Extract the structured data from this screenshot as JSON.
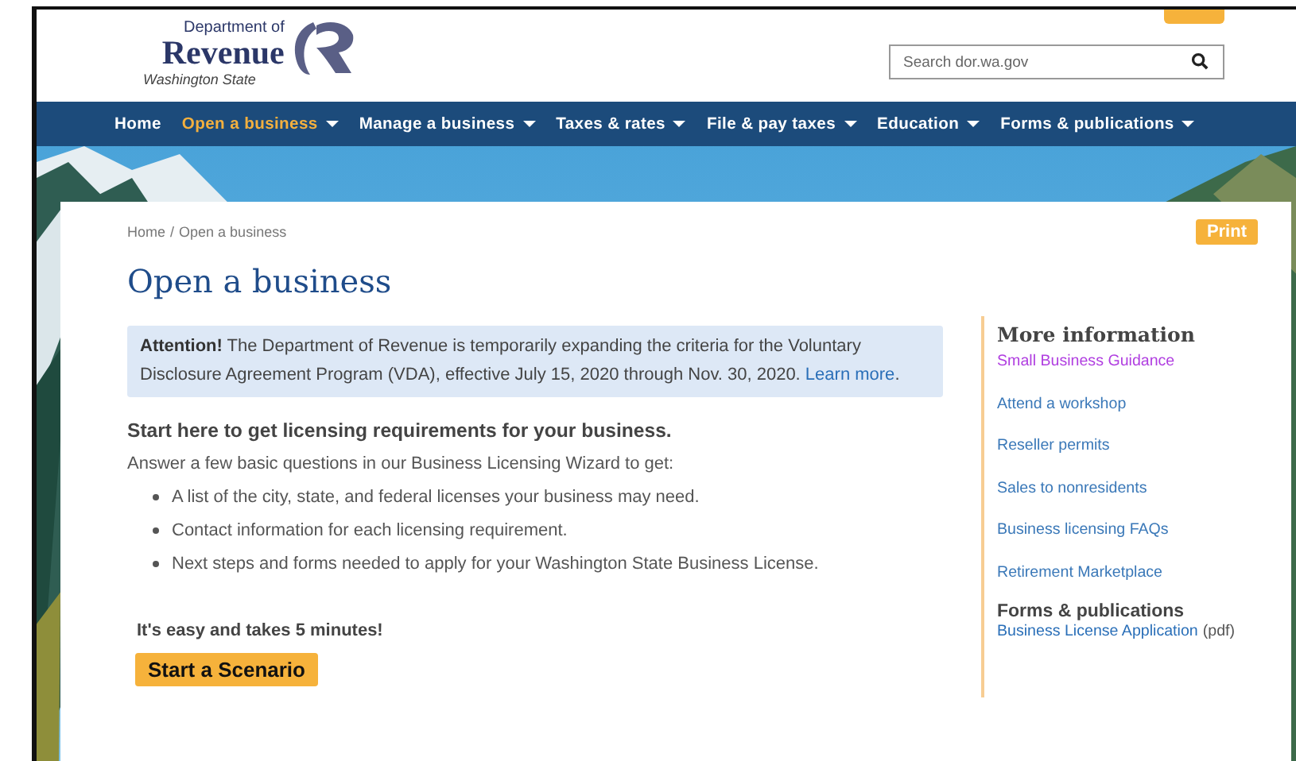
{
  "header": {
    "logo": {
      "line_1": "Department of",
      "line_2": "Revenue",
      "line_3": "Washington State"
    },
    "search": {
      "placeholder": "Search dor.wa.gov"
    }
  },
  "nav": [
    {
      "label": "Home",
      "selected": false,
      "dropdown": false
    },
    {
      "label": "Open a business",
      "selected": true,
      "dropdown": true
    },
    {
      "label": "Manage a business",
      "selected": false,
      "dropdown": true
    },
    {
      "label": "Taxes & rates",
      "selected": false,
      "dropdown": true
    },
    {
      "label": "File & pay taxes",
      "selected": false,
      "dropdown": true
    },
    {
      "label": "Education",
      "selected": false,
      "dropdown": true
    },
    {
      "label": "Forms & publications",
      "selected": false,
      "dropdown": true
    }
  ],
  "breadcrumb": {
    "items": [
      "Home",
      "Open a business"
    ],
    "separator": "/"
  },
  "print_button": "Print",
  "title": "Open a business",
  "alert": {
    "text": "**Attention!** The Department of Revenue is temporarily expanding the criteria for the Voluntary Disclosure Agreement Program (VDA), effective July 15, 2020 through Nov. 30, 2020. ",
    "link": "Learn more",
    "end": "."
  },
  "intro": {
    "heading": "Start here to get licensing requirements for your business.",
    "lead": "Answer a few basic questions in our Business Licensing Wizard to get:",
    "bullets": [
      "A list of the city, state, and federal licenses your business may need.",
      "Contact information for each licensing requirement.",
      "Next steps and forms needed to apply for your Washington State Business License."
    ]
  },
  "cta": {
    "note": "It's easy and takes 5 minutes!",
    "button": "Start a Scenario"
  },
  "sidebar": {
    "heading": "More information",
    "links": [
      {
        "label": "Small Business Guidance",
        "visited": true
      },
      {
        "label": "Attend a workshop",
        "visited": false
      },
      {
        "label": "Reseller permits",
        "visited": false
      },
      {
        "label": "Sales to nonresidents",
        "visited": false
      },
      {
        "label": "Business licensing FAQs",
        "visited": false
      },
      {
        "label": "Retirement Marketplace",
        "visited": false
      }
    ],
    "forms_heading": "Forms & publications",
    "forms": [
      {
        "label": "Business License Application",
        "suffix": "(pdf)"
      }
    ]
  }
}
